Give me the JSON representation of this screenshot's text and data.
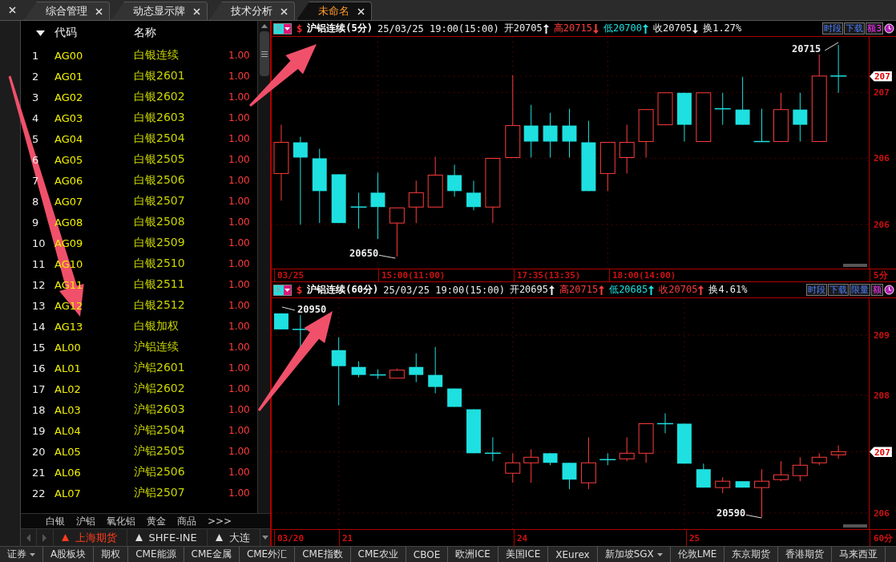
{
  "tabs": [
    {
      "label": "综合管理",
      "selected": false
    },
    {
      "label": "动态显示牌",
      "selected": false
    },
    {
      "label": "技术分析",
      "selected": false
    },
    {
      "label": "未命名",
      "selected": true
    }
  ],
  "list": {
    "columns": [
      "代码",
      "名称"
    ],
    "rows": [
      {
        "num": "1",
        "code": "AG00",
        "name": "白银连续",
        "value": "1.00"
      },
      {
        "num": "2",
        "code": "AG01",
        "name": "白银2601",
        "value": "1.00"
      },
      {
        "num": "3",
        "code": "AG02",
        "name": "白银2602",
        "value": "1.00"
      },
      {
        "num": "4",
        "code": "AG03",
        "name": "白银2603",
        "value": "1.00"
      },
      {
        "num": "5",
        "code": "AG04",
        "name": "白银2504",
        "value": "1.00"
      },
      {
        "num": "6",
        "code": "AG05",
        "name": "白银2505",
        "value": "1.00"
      },
      {
        "num": "7",
        "code": "AG06",
        "name": "白银2506",
        "value": "1.00"
      },
      {
        "num": "8",
        "code": "AG07",
        "name": "白银2507",
        "value": "1.00"
      },
      {
        "num": "9",
        "code": "AG08",
        "name": "白银2508",
        "value": "1.00"
      },
      {
        "num": "10",
        "code": "AG09",
        "name": "白银2509",
        "value": "1.00"
      },
      {
        "num": "11",
        "code": "AG10",
        "name": "白银2510",
        "value": "1.00"
      },
      {
        "num": "12",
        "code": "AG11",
        "name": "白银2511",
        "value": "1.00"
      },
      {
        "num": "13",
        "code": "AG12",
        "name": "白银2512",
        "value": "1.00"
      },
      {
        "num": "14",
        "code": "AG13",
        "name": "白银加权",
        "value": "1.00"
      },
      {
        "num": "15",
        "code": "AL00",
        "name": "沪铝连续",
        "value": "1.00"
      },
      {
        "num": "16",
        "code": "AL01",
        "name": "沪铝2601",
        "value": "1.00"
      },
      {
        "num": "17",
        "code": "AL02",
        "name": "沪铝2602",
        "value": "1.00"
      },
      {
        "num": "18",
        "code": "AL03",
        "name": "沪铝2603",
        "value": "1.00"
      },
      {
        "num": "19",
        "code": "AL04",
        "name": "沪铝2504",
        "value": "1.00"
      },
      {
        "num": "20",
        "code": "AL05",
        "name": "沪铝2505",
        "value": "1.00"
      },
      {
        "num": "21",
        "code": "AL06",
        "name": "沪铝2506",
        "value": "1.00"
      },
      {
        "num": "22",
        "code": "AL07",
        "name": "沪铝2507",
        "value": "1.00"
      }
    ]
  },
  "categories": [
    "白银",
    "沪铝",
    "氧化铝",
    "黄金",
    "商品",
    ">>>"
  ],
  "exchanges": [
    {
      "label": "上海期货",
      "selected": true
    },
    {
      "label": "SHFE-INE",
      "selected": false
    },
    {
      "label": "大连",
      "selected": false
    }
  ],
  "charts": [
    {
      "mode": "K",
      "symbol": "$",
      "title": "沪铝连续(5分)",
      "time": "25/03/25 19:00(15:00)",
      "quotes": [
        {
          "text": "开20705",
          "kind": "neutral",
          "rising": true
        },
        {
          "text": "高20715",
          "kind": "gain",
          "rising": false
        },
        {
          "text": "低20700",
          "kind": "loss",
          "rising": true
        },
        {
          "text": "收20705",
          "kind": "neutral",
          "rising": false
        },
        {
          "text": "换1.27%",
          "kind": "neutral"
        }
      ],
      "buttons": [
        {
          "label": "时段",
          "highlight": false
        },
        {
          "label": "下载",
          "highlight": false
        },
        {
          "label": "额3",
          "highlight": true
        }
      ],
      "y_labels": [
        {
          "text": "207",
          "current": true
        },
        {
          "text": "207",
          "current": false
        },
        {
          "text": "206",
          "current": false
        },
        {
          "text": "206",
          "current": false
        }
      ],
      "x_labels": [
        "03/25",
        "15:00(11:00)",
        "17:35(13:35)",
        "18:00(14:00)"
      ],
      "period": "5分",
      "annotations": [
        "20715",
        "20650"
      ]
    },
    {
      "mode": "K",
      "symbol": "$",
      "title": "沪铝连续(60分)",
      "time": "25/03/25 19:00(15:00)",
      "quotes": [
        {
          "text": "开20695",
          "kind": "neutral",
          "rising": true
        },
        {
          "text": "高20715",
          "kind": "gain",
          "rising": true
        },
        {
          "text": "低20685",
          "kind": "loss",
          "rising": true
        },
        {
          "text": "收20705",
          "kind": "gain",
          "rising": true
        },
        {
          "text": "换4.61%",
          "kind": "neutral"
        }
      ],
      "buttons": [
        {
          "label": "时段",
          "highlight": false
        },
        {
          "label": "下载",
          "highlight": false
        },
        {
          "label": "限量",
          "highlight": false
        },
        {
          "label": "额",
          "highlight": true
        }
      ],
      "y_labels": [
        {
          "text": "209",
          "current": false
        },
        {
          "text": "208",
          "current": false
        },
        {
          "text": "207",
          "current": true
        },
        {
          "text": "206",
          "current": false
        }
      ],
      "x_labels": [
        "03/20",
        "21",
        "24",
        "25"
      ],
      "period": "60分",
      "annotations": [
        "20950",
        "20590"
      ]
    }
  ],
  "status_bar": [
    {
      "label": "证券",
      "dropdown": true
    },
    {
      "label": "A股板块",
      "dropdown": false
    },
    {
      "label": "期权",
      "dropdown": false
    },
    {
      "label": "CME能源",
      "dropdown": false
    },
    {
      "label": "CME金属",
      "dropdown": false
    },
    {
      "label": "CME外汇",
      "dropdown": false
    },
    {
      "label": "CME指数",
      "dropdown": false
    },
    {
      "label": "CME农业",
      "dropdown": false
    },
    {
      "label": "CBOE",
      "dropdown": false
    },
    {
      "label": "欧洲ICE",
      "dropdown": false
    },
    {
      "label": "美国ICE",
      "dropdown": false
    },
    {
      "label": "XEurex",
      "dropdown": false
    },
    {
      "label": "新加坡SGX",
      "dropdown": true
    },
    {
      "label": "伦敦LME",
      "dropdown": false
    },
    {
      "label": "东京期货",
      "dropdown": false
    },
    {
      "label": "香港期货",
      "dropdown": false
    },
    {
      "label": "马来西亚",
      "dropdown": false
    }
  ]
}
